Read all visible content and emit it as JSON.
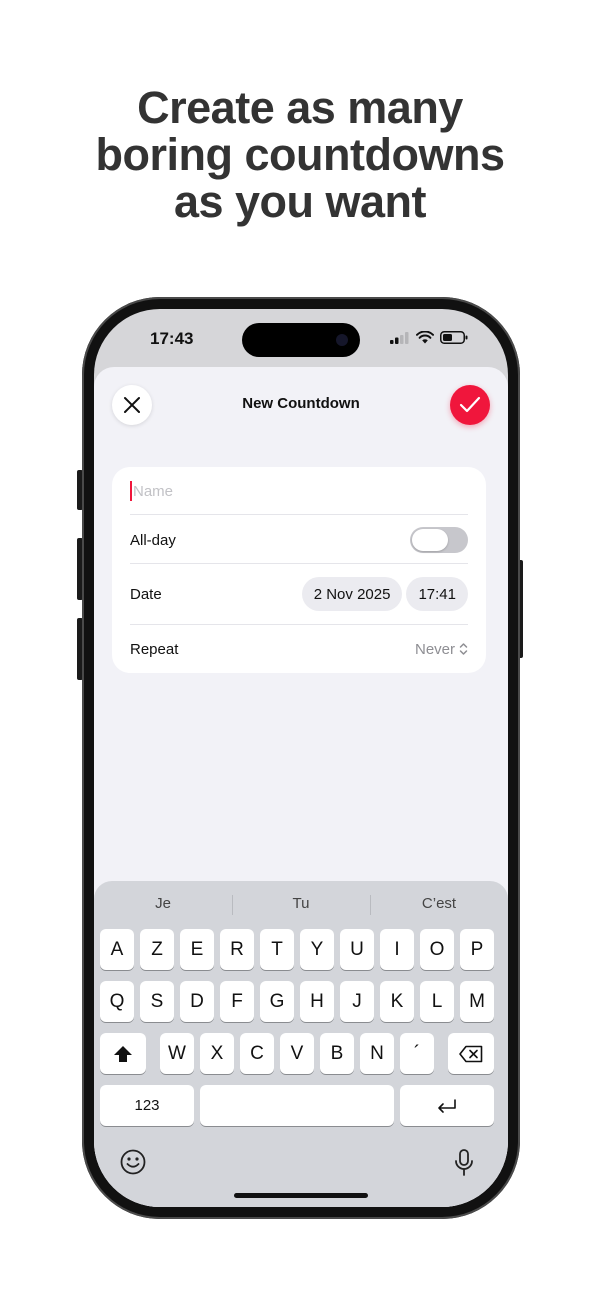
{
  "headline": {
    "line1": "Create as many",
    "line2": "boring countdowns",
    "line3": "as you want"
  },
  "status_bar": {
    "time": "17:43"
  },
  "sheet": {
    "title": "New Countdown",
    "close_icon": "close-icon",
    "confirm_icon": "checkmark-icon",
    "accent_color": "#f0163c"
  },
  "form": {
    "name_placeholder": "Name",
    "name_value": "",
    "all_day_label": "All-day",
    "all_day_on": false,
    "date_label": "Date",
    "date_value": "2 Nov 2025",
    "time_value": "17:41",
    "repeat_label": "Repeat",
    "repeat_value": "Never"
  },
  "keyboard": {
    "suggestions": [
      "Je",
      "Tu",
      "C’est"
    ],
    "row1": [
      "A",
      "Z",
      "E",
      "R",
      "T",
      "Y",
      "U",
      "I",
      "O",
      "P"
    ],
    "row2": [
      "Q",
      "S",
      "D",
      "F",
      "G",
      "H",
      "J",
      "K",
      "L",
      "M"
    ],
    "row3": [
      "W",
      "X",
      "C",
      "V",
      "B",
      "N",
      "´"
    ],
    "numbers_label": "123"
  }
}
